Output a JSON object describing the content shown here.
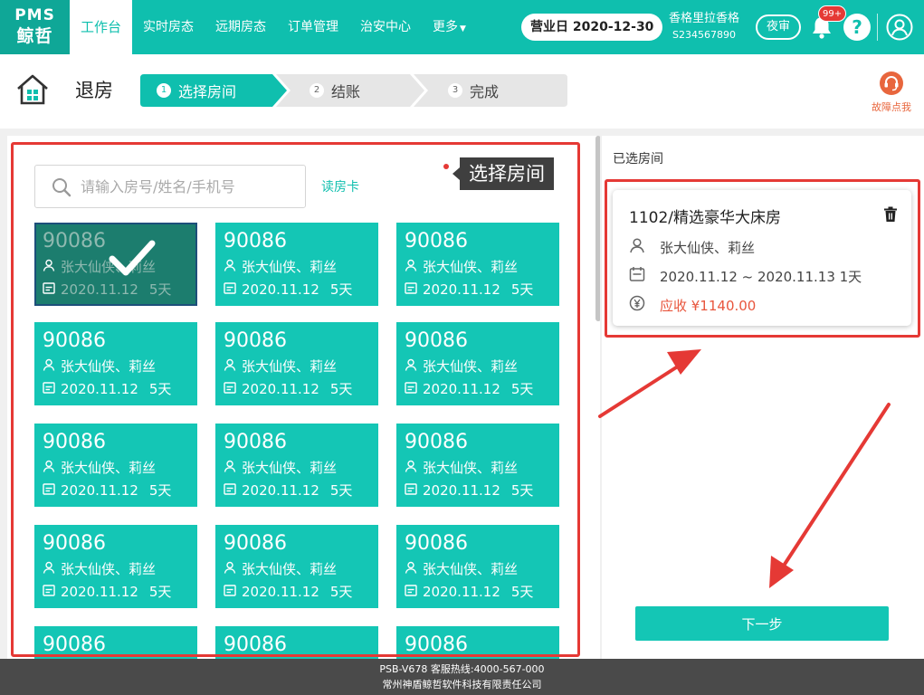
{
  "logo": {
    "line1": "PMS",
    "line2": "鲸哲"
  },
  "nav": {
    "items": [
      {
        "label": "工作台",
        "active": true
      },
      {
        "label": "实时房态",
        "active": false
      },
      {
        "label": "远期房态",
        "active": false
      },
      {
        "label": "订单管理",
        "active": false
      },
      {
        "label": "治安中心",
        "active": false
      },
      {
        "label": "更多",
        "active": false,
        "caret": "▼"
      }
    ],
    "business_day": "营业日 2020-12-30",
    "hotel_name": "香格里拉香格",
    "hotel_code": "S234567890",
    "night_audit_label": "夜审",
    "notifications_badge": "99+",
    "help_glyph": "?"
  },
  "page": {
    "title": "退房",
    "steps": [
      {
        "num": "1",
        "label": "选择房间",
        "active": true
      },
      {
        "num": "2",
        "label": "结账",
        "active": false
      },
      {
        "num": "3",
        "label": "完成",
        "active": false
      }
    ],
    "fault_report_label": "故障点我"
  },
  "search": {
    "placeholder": "请输入房号/姓名/手机号",
    "value": "",
    "read_card_label": "读房卡"
  },
  "tooltip": {
    "text": "选择房间"
  },
  "rooms": [
    {
      "room_no": "90086",
      "guests": "张大仙侠、莉丝",
      "date": "2020.11.12",
      "nights": "5天",
      "selected": true
    },
    {
      "room_no": "90086",
      "guests": "张大仙侠、莉丝",
      "date": "2020.11.12",
      "nights": "5天",
      "selected": false
    },
    {
      "room_no": "90086",
      "guests": "张大仙侠、莉丝",
      "date": "2020.11.12",
      "nights": "5天",
      "selected": false
    },
    {
      "room_no": "90086",
      "guests": "张大仙侠、莉丝",
      "date": "2020.11.12",
      "nights": "5天",
      "selected": false
    },
    {
      "room_no": "90086",
      "guests": "张大仙侠、莉丝",
      "date": "2020.11.12",
      "nights": "5天",
      "selected": false
    },
    {
      "room_no": "90086",
      "guests": "张大仙侠、莉丝",
      "date": "2020.11.12",
      "nights": "5天",
      "selected": false
    },
    {
      "room_no": "90086",
      "guests": "张大仙侠、莉丝",
      "date": "2020.11.12",
      "nights": "5天",
      "selected": false
    },
    {
      "room_no": "90086",
      "guests": "张大仙侠、莉丝",
      "date": "2020.11.12",
      "nights": "5天",
      "selected": false
    },
    {
      "room_no": "90086",
      "guests": "张大仙侠、莉丝",
      "date": "2020.11.12",
      "nights": "5天",
      "selected": false
    },
    {
      "room_no": "90086",
      "guests": "张大仙侠、莉丝",
      "date": "2020.11.12",
      "nights": "5天",
      "selected": false
    },
    {
      "room_no": "90086",
      "guests": "张大仙侠、莉丝",
      "date": "2020.11.12",
      "nights": "5天",
      "selected": false
    },
    {
      "room_no": "90086",
      "guests": "张大仙侠、莉丝",
      "date": "2020.11.12",
      "nights": "5天",
      "selected": false
    },
    {
      "room_no": "90086",
      "guests": "",
      "date": "",
      "nights": "",
      "selected": false
    },
    {
      "room_no": "90086",
      "guests": "",
      "date": "",
      "nights": "",
      "selected": false
    },
    {
      "room_no": "90086",
      "guests": "",
      "date": "",
      "nights": "",
      "selected": false
    }
  ],
  "selected_panel": {
    "label": "已选房间",
    "room": {
      "title": "1102/精选豪华大床房",
      "guests": "张大仙侠、莉丝",
      "dates": "2020.11.12 ~ 2020.11.13  1天",
      "amount": "应收 ¥1140.00"
    },
    "next_button": "下一步"
  },
  "footer": {
    "line1": "PSB-V678   客服热线:4000-567-000",
    "line2": "常州神盾鲸哲软件科技有限责任公司"
  },
  "colors": {
    "brand": "#0fbfae",
    "brand_dark": "#0fa797",
    "card": "#14c6b5",
    "card_selected": "#1c7d6e",
    "annotation": "#e53935",
    "amount": "#e8563d"
  }
}
